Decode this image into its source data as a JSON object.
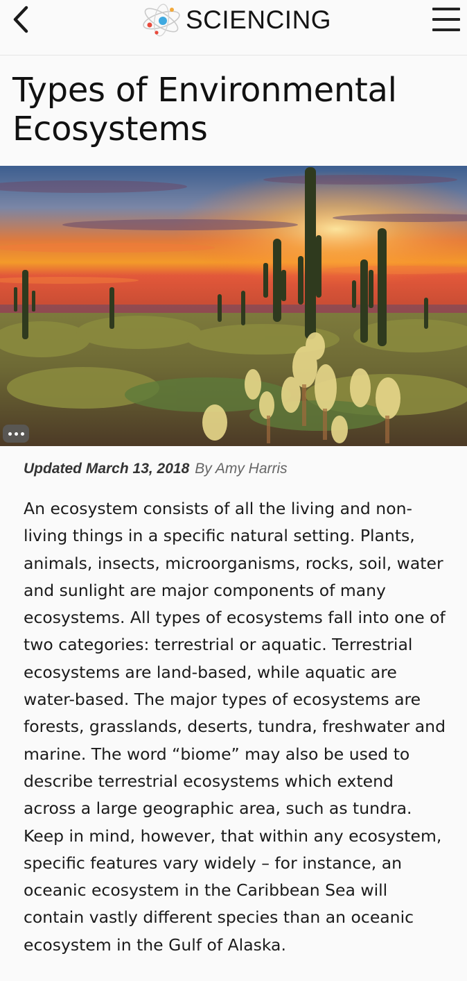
{
  "header": {
    "logo_text": "SCIENCING",
    "back_icon": "chevron-left-icon",
    "menu_icon": "hamburger-menu-icon"
  },
  "article": {
    "title": "Types of Environmental Ecosystems",
    "updated": "Updated March 13, 2018",
    "author": "By Amy Harris",
    "body": "An ecosystem consists of all the living and non-living things in a specific natural setting. Plants, animals, insects, microorganisms, rocks, soil, water and sunlight are major components of many ecosystems. All types of ecosystems fall into one of two categories: terrestrial or aquatic. Terrestrial ecosystems are land-based, while aquatic are water-based. The major types of ecosystems are forests, grasslands, deserts, tundra, freshwater and marine. The word “biome” may also be used to describe terrestrial ecosystems which extend across a large geographic area, such as tundra. Keep in mind, however, that within any ecosystem, specific features vary widely – for instance, an oceanic ecosystem in the Caribbean Sea will contain vastly different species than an oceanic ecosystem in the Gulf of Alaska."
  },
  "hero": {
    "more_icon": "ellipsis-icon"
  },
  "colors": {
    "background": "#fafafa",
    "text": "#1a1a1a",
    "byline": "#555555"
  }
}
